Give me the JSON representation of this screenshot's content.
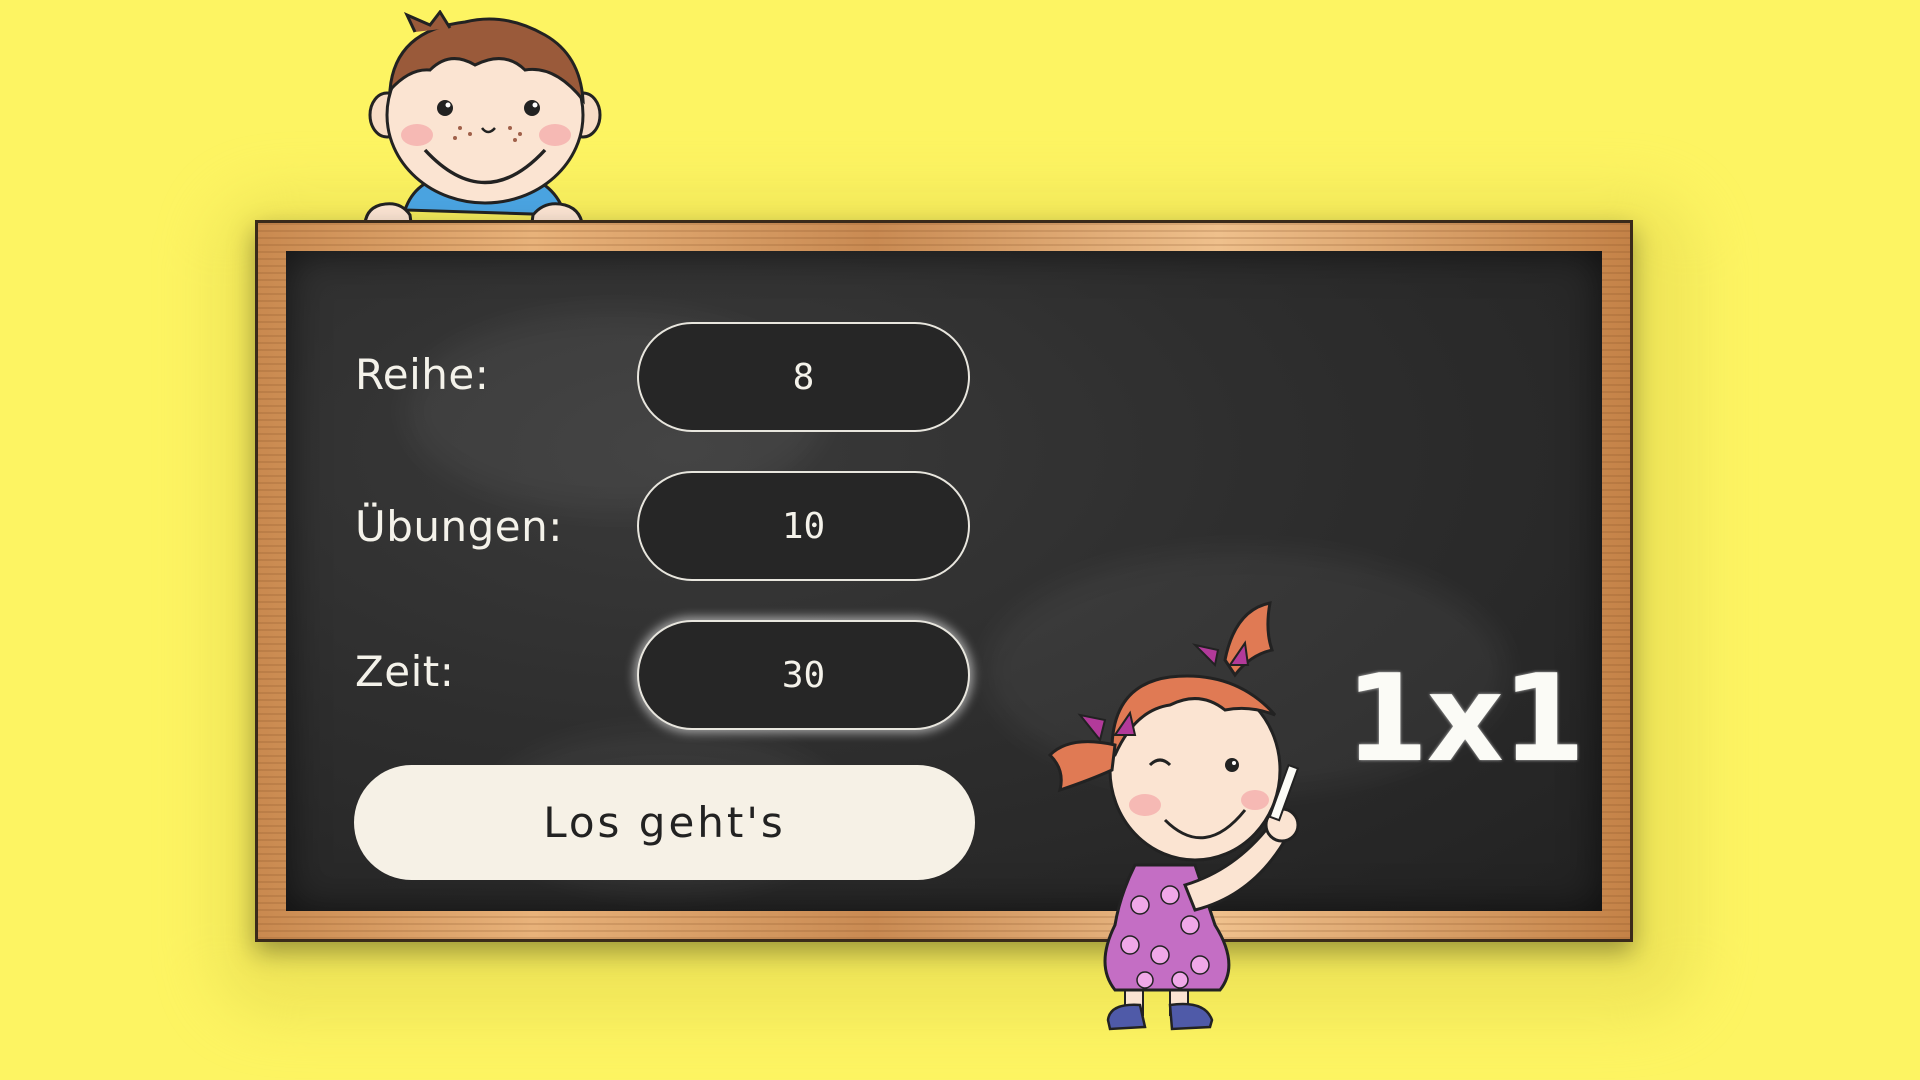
{
  "form": {
    "row_label": "Reihe:",
    "row_value": "8",
    "exercises_label": "Übungen:",
    "exercises_value": "10",
    "time_label": "Zeit:",
    "time_value": "30",
    "start_button": "Los geht's"
  },
  "board_chalk_text": "1x1",
  "icons": [
    "boy-character-icon",
    "girl-character-icon"
  ],
  "colors": {
    "background": "#fdf462",
    "chalkboard": "#2e2e2e",
    "frame_wood": "#d79c62",
    "button": "#f6f1e6"
  }
}
